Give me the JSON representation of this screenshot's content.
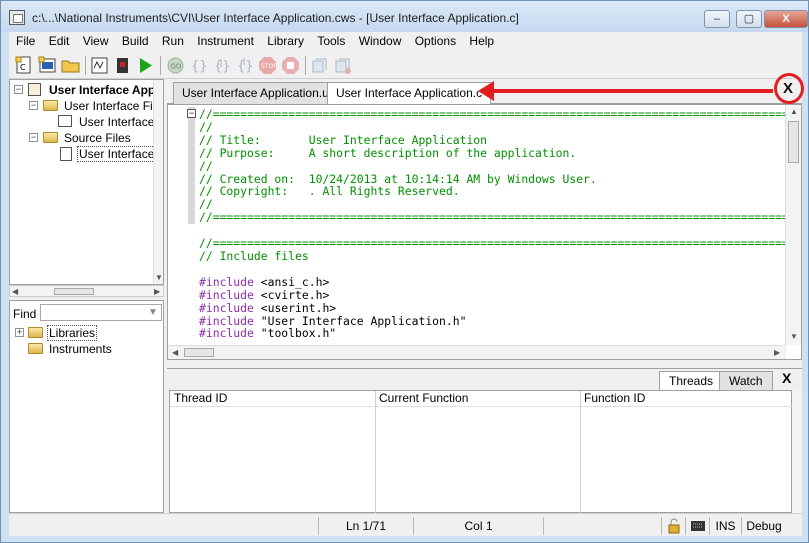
{
  "window": {
    "title": "c:\\...\\National Instruments\\CVI\\User Interface Application.cws - [User Interface Application.c]",
    "minimize": "–",
    "maximize": "▢",
    "close": "X"
  },
  "menu": [
    "File",
    "Edit",
    "View",
    "Build",
    "Run",
    "Instrument",
    "Library",
    "Tools",
    "Window",
    "Options",
    "Help"
  ],
  "toolbar_icons": [
    "new-c-file-icon",
    "new-uir-icon",
    "open-folder-icon",
    "compile-icon",
    "debug-stop-icon",
    "run-icon",
    "go-icon",
    "step-over-icon",
    "step-into-icon",
    "step-out-icon",
    "stop-icon",
    "break-icon",
    "toggle-breakpoint-icon",
    "breakpoints-icon"
  ],
  "project_tree": {
    "root": "User Interface App",
    "group1": "User Interface Files",
    "file1": "User Interface A",
    "group2": "Source Files",
    "file2": "User Interface A"
  },
  "find": {
    "label": "Find",
    "value": "",
    "items": [
      "Libraries",
      "Instruments"
    ]
  },
  "tabs": [
    "User Interface Application.uir",
    "User Interface Application.c"
  ],
  "code_lines": [
    {
      "t": "comment",
      "s": "//========================================================================================"
    },
    {
      "t": "comment",
      "s": "//"
    },
    {
      "t": "comment",
      "s": "// Title:       User Interface Application"
    },
    {
      "t": "comment",
      "s": "// Purpose:     A short description of the application."
    },
    {
      "t": "comment",
      "s": "//"
    },
    {
      "t": "comment",
      "s": "// Created on:  10/24/2013 at 10:14:14 AM by Windows User."
    },
    {
      "t": "comment",
      "s": "// Copyright:   . All Rights Reserved."
    },
    {
      "t": "comment",
      "s": "//"
    },
    {
      "t": "comment",
      "s": "//========================================================================================"
    },
    {
      "t": "blank",
      "s": ""
    },
    {
      "t": "comment",
      "s": "//========================================================================================"
    },
    {
      "t": "comment",
      "s": "// Include files"
    },
    {
      "t": "blank",
      "s": ""
    },
    {
      "t": "include",
      "k": "#include",
      "s": " <ansi_c.h>"
    },
    {
      "t": "include",
      "k": "#include",
      "s": " <cvirte.h>"
    },
    {
      "t": "include",
      "k": "#include",
      "s": " <userint.h>"
    },
    {
      "t": "include",
      "k": "#include",
      "s": " \"User Interface Application.h\""
    },
    {
      "t": "include",
      "k": "#include",
      "s": " \"toolbox.h\""
    }
  ],
  "panel": {
    "tabs": [
      "Threads",
      "Watch"
    ],
    "close": "X",
    "columns": [
      "Thread ID",
      "Current Function",
      "Function ID"
    ]
  },
  "status": {
    "position": "Ln 1/71",
    "column": "Col 1",
    "mode": "INS",
    "config": "Debug"
  },
  "annotation_color": "#e21e1e"
}
